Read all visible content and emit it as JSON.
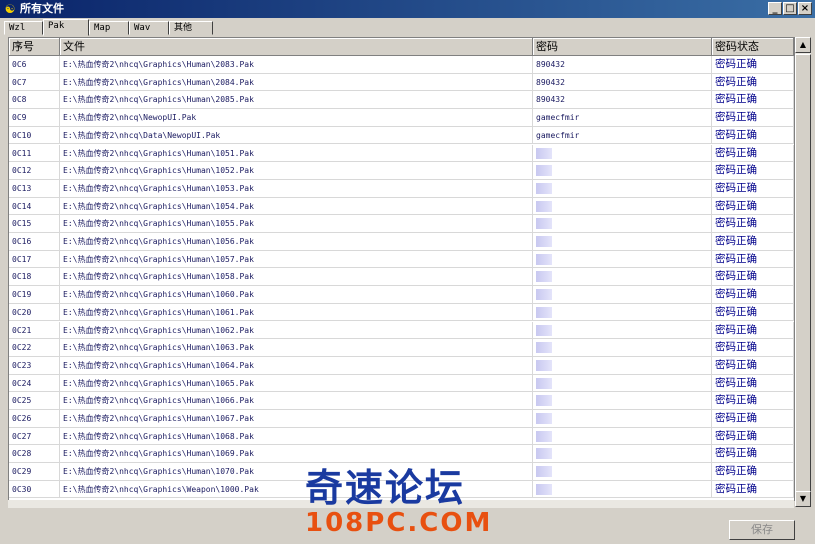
{
  "window": {
    "title": "所有文件",
    "app_icon": "yin-yang-icon",
    "controls": [
      "_",
      "□",
      "×"
    ]
  },
  "tabs": [
    {
      "label": "Wzl",
      "active": false
    },
    {
      "label": "Pak",
      "active": true
    },
    {
      "label": "Map",
      "active": false
    },
    {
      "label": "Wav",
      "active": false
    },
    {
      "label": "其他",
      "active": false
    }
  ],
  "table": {
    "columns": [
      "序号",
      "文件",
      "密码",
      "密码状态"
    ],
    "rows": [
      {
        "id": "0C6",
        "file": "E:\\热血传奇2\\nhcq\\Graphics\\Human\\2083.Pak",
        "password": "890432",
        "status": "密码正确"
      },
      {
        "id": "0C7",
        "file": "E:\\热血传奇2\\nhcq\\Graphics\\Human\\2084.Pak",
        "password": "890432",
        "status": "密码正确"
      },
      {
        "id": "0C8",
        "file": "E:\\热血传奇2\\nhcq\\Graphics\\Human\\2085.Pak",
        "password": "890432",
        "status": "密码正确"
      },
      {
        "id": "0C9",
        "file": "E:\\热血传奇2\\nhcq\\NewopUI.Pak",
        "password": "gamecfmir",
        "status": "密码正确"
      },
      {
        "id": "0C10",
        "file": "E:\\热血传奇2\\nhcq\\Data\\NewopUI.Pak",
        "password": "gamecfmir",
        "status": "密码正确"
      },
      {
        "id": "0C11",
        "file": "E:\\热血传奇2\\nhcq\\Graphics\\Human\\1051.Pak",
        "password": "",
        "status": "密码正确"
      },
      {
        "id": "0C12",
        "file": "E:\\热血传奇2\\nhcq\\Graphics\\Human\\1052.Pak",
        "password": "",
        "status": "密码正确"
      },
      {
        "id": "0C13",
        "file": "E:\\热血传奇2\\nhcq\\Graphics\\Human\\1053.Pak",
        "password": "",
        "status": "密码正确"
      },
      {
        "id": "0C14",
        "file": "E:\\热血传奇2\\nhcq\\Graphics\\Human\\1054.Pak",
        "password": "",
        "status": "密码正确"
      },
      {
        "id": "0C15",
        "file": "E:\\热血传奇2\\nhcq\\Graphics\\Human\\1055.Pak",
        "password": "",
        "status": "密码正确"
      },
      {
        "id": "0C16",
        "file": "E:\\热血传奇2\\nhcq\\Graphics\\Human\\1056.Pak",
        "password": "",
        "status": "密码正确"
      },
      {
        "id": "0C17",
        "file": "E:\\热血传奇2\\nhcq\\Graphics\\Human\\1057.Pak",
        "password": "",
        "status": "密码正确"
      },
      {
        "id": "0C18",
        "file": "E:\\热血传奇2\\nhcq\\Graphics\\Human\\1058.Pak",
        "password": "",
        "status": "密码正确"
      },
      {
        "id": "0C19",
        "file": "E:\\热血传奇2\\nhcq\\Graphics\\Human\\1060.Pak",
        "password": "",
        "status": "密码正确"
      },
      {
        "id": "0C20",
        "file": "E:\\热血传奇2\\nhcq\\Graphics\\Human\\1061.Pak",
        "password": "",
        "status": "密码正确"
      },
      {
        "id": "0C21",
        "file": "E:\\热血传奇2\\nhcq\\Graphics\\Human\\1062.Pak",
        "password": "",
        "status": "密码正确"
      },
      {
        "id": "0C22",
        "file": "E:\\热血传奇2\\nhcq\\Graphics\\Human\\1063.Pak",
        "password": "",
        "status": "密码正确"
      },
      {
        "id": "0C23",
        "file": "E:\\热血传奇2\\nhcq\\Graphics\\Human\\1064.Pak",
        "password": "",
        "status": "密码正确"
      },
      {
        "id": "0C24",
        "file": "E:\\热血传奇2\\nhcq\\Graphics\\Human\\1065.Pak",
        "password": "",
        "status": "密码正确"
      },
      {
        "id": "0C25",
        "file": "E:\\热血传奇2\\nhcq\\Graphics\\Human\\1066.Pak",
        "password": "",
        "status": "密码正确"
      },
      {
        "id": "0C26",
        "file": "E:\\热血传奇2\\nhcq\\Graphics\\Human\\1067.Pak",
        "password": "",
        "status": "密码正确"
      },
      {
        "id": "0C27",
        "file": "E:\\热血传奇2\\nhcq\\Graphics\\Human\\1068.Pak",
        "password": "",
        "status": "密码正确"
      },
      {
        "id": "0C28",
        "file": "E:\\热血传奇2\\nhcq\\Graphics\\Human\\1069.Pak",
        "password": "",
        "status": "密码正确"
      },
      {
        "id": "0C29",
        "file": "E:\\热血传奇2\\nhcq\\Graphics\\Human\\1070.Pak",
        "password": "",
        "status": "密码正确"
      },
      {
        "id": "0C30",
        "file": "E:\\热血传奇2\\nhcq\\Graphics\\Weapon\\1000.Pak",
        "password": "",
        "status": "密码正确"
      }
    ]
  },
  "save_button": {
    "label": "保存",
    "enabled": false
  },
  "watermark": {
    "line1": "奇速论坛",
    "line2": "108PC.COM"
  }
}
